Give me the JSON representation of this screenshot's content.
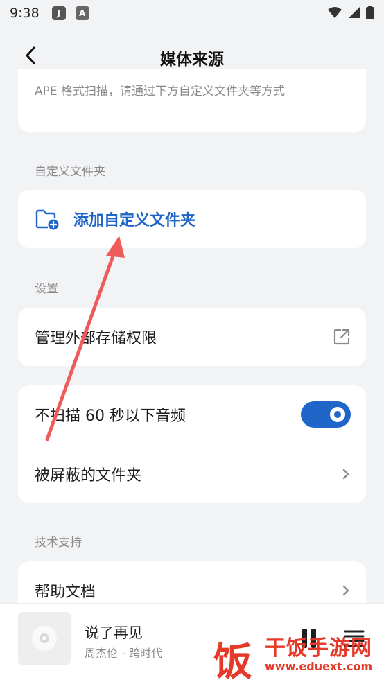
{
  "status_bar": {
    "time": "9:38",
    "app_icon_1": "J",
    "app_icon_2": "A"
  },
  "header": {
    "title": "媒体来源"
  },
  "description": {
    "text": "APE 格式扫描，请通过下方自定义文件夹等方式"
  },
  "sections": {
    "custom_folder_label": "自定义文件夹",
    "settings_label": "设置",
    "support_label": "技术支持"
  },
  "custom_folder": {
    "add_label": "添加自定义文件夹"
  },
  "settings": {
    "storage_permission": "管理外部存储权限",
    "skip_short_audio": "不扫描 60 秒以下音频",
    "skip_short_audio_enabled": true,
    "blocked_folders": "被屏蔽的文件夹"
  },
  "support": {
    "help_docs": "帮助文档"
  },
  "player": {
    "song_title": "说了再见",
    "artist": "周杰伦 - 跨时代"
  },
  "watermark": {
    "logo_char": "饭",
    "site_name": "干饭手游网",
    "url": "www.eduext.com"
  },
  "colors": {
    "accent": "#1f66c8",
    "annotation_arrow": "#ef5a5a",
    "watermark": "#e53a2a"
  }
}
